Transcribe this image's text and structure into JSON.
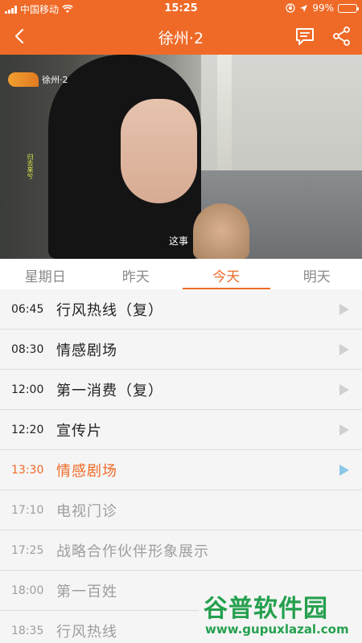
{
  "status": {
    "carrier": "中国移动",
    "time": "15:25",
    "battery": "99%",
    "battery_level": 0.99
  },
  "nav": {
    "title": "徐州·2"
  },
  "video": {
    "channel_logo_text": "徐州·2",
    "vertical_caption": "归去来兮",
    "subtitle": "这事"
  },
  "tabs": [
    {
      "label": "星期日"
    },
    {
      "label": "昨天"
    },
    {
      "label": "今天"
    },
    {
      "label": "明天"
    }
  ],
  "schedule": [
    {
      "time": "06:45",
      "title": "行风热线（复）"
    },
    {
      "time": "08:30",
      "title": "情感剧场"
    },
    {
      "time": "12:00",
      "title": "第一消费（复）"
    },
    {
      "time": "12:20",
      "title": "宣传片"
    },
    {
      "time": "13:30",
      "title": "情感剧场"
    },
    {
      "time": "17:10",
      "title": "电视门诊"
    },
    {
      "time": "17:25",
      "title": "战略合作伙伴形象展示"
    },
    {
      "time": "18:00",
      "title": "第一百姓"
    },
    {
      "time": "18:35",
      "title": "行风热线"
    }
  ],
  "watermark": {
    "title": "谷普软件园",
    "url": "www.gupuxlazal.com"
  },
  "colors": {
    "accent": "#ef6a27",
    "past_text": "#9e9e9e",
    "play_active": "#8cc8e8"
  }
}
